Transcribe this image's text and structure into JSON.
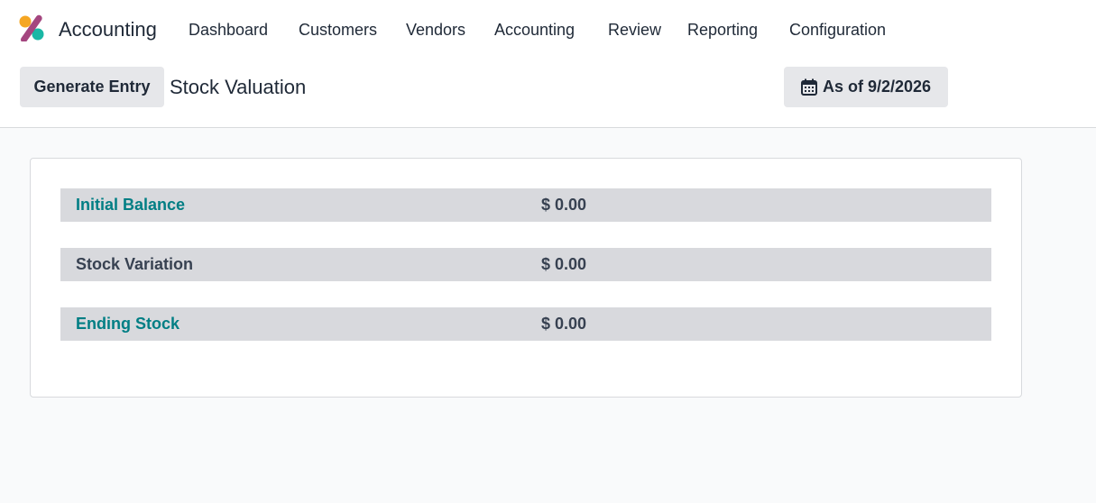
{
  "app": {
    "name": "Accounting",
    "icon": "odoo-accounting-app-icon"
  },
  "menu": [
    {
      "label": "Dashboard"
    },
    {
      "label": "Customers"
    },
    {
      "label": "Vendors"
    },
    {
      "label": "Accounting"
    },
    {
      "label": "Review"
    },
    {
      "label": "Reporting"
    },
    {
      "label": "Configuration"
    }
  ],
  "controls": {
    "generate_label": "Generate Entry",
    "page_title": "Stock Valuation",
    "date_label": "As of 9/2/2026",
    "date_icon": "calendar-icon"
  },
  "report": {
    "rows": [
      {
        "label": "Initial Balance",
        "value": "$ 0.00",
        "link": true
      },
      {
        "label": "Stock Variation",
        "value": "$ 0.00",
        "link": false
      },
      {
        "label": "Ending Stock",
        "value": "$ 0.00",
        "link": true
      }
    ]
  },
  "colors": {
    "link": "#017e84",
    "row_background": "#d8d9dd",
    "button_background": "#e6e7ea",
    "page_background": "#f9fafb"
  }
}
